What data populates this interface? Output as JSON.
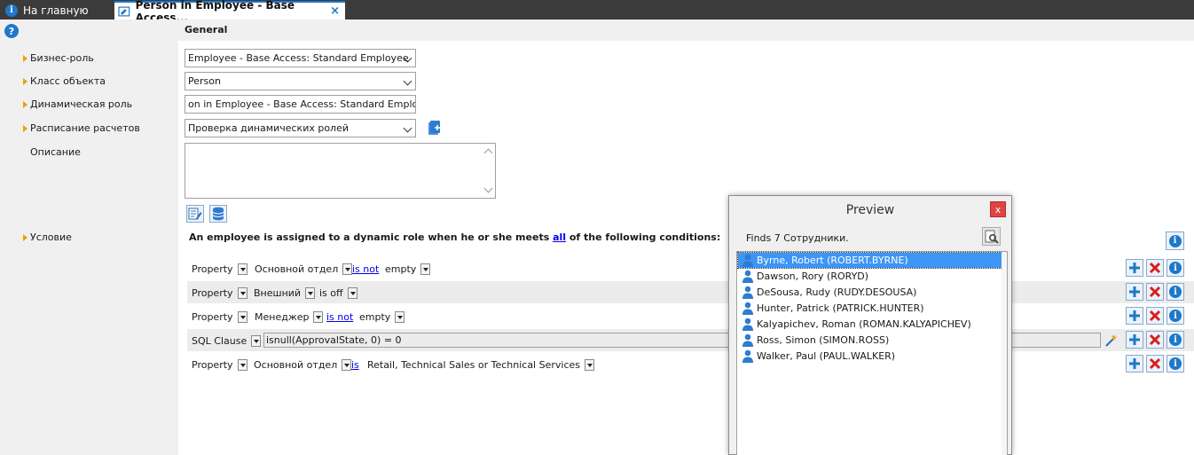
{
  "tabs": {
    "home_label": "На главную",
    "active_label": "Person in Employee - Base Access...",
    "close_symbol": "×"
  },
  "help_symbol": "?",
  "section_title": "General",
  "fields": {
    "business_role_label": "Бизнес-роль",
    "business_role_value": "Employee - Base Access: Standard Employee",
    "object_class_label": "Класс объекта",
    "object_class_value": "Person",
    "dynamic_role_label": "Динамическая роль",
    "dynamic_role_value": "on in Employee - Base Access: Standard Employee",
    "schedule_label": "Расписание расчетов",
    "schedule_value": "Проверка динамических ролей",
    "description_label": "Описание",
    "description_value": "",
    "condition_label": "Условие"
  },
  "condition": {
    "title_before": "An employee is assigned to a dynamic role when he or she meets ",
    "title_link": "all",
    "title_after": " of the following conditions:",
    "rows": [
      {
        "type": "Property",
        "property": "Основной отдел",
        "operator": "is not",
        "value": "empty"
      },
      {
        "type": "Property",
        "property": "Внешний",
        "operator": "is off"
      },
      {
        "type": "Property",
        "property": "Менеджер",
        "operator": "is not",
        "value": "empty"
      },
      {
        "type": "SQL Clause",
        "sql": "isnull(ApprovalState, 0) = 0"
      },
      {
        "type": "Property",
        "property": "Основной отдел",
        "operator": "is",
        "value": "Retail, Technical Sales or Technical Services"
      }
    ]
  },
  "preview": {
    "title": "Preview",
    "close_symbol": "x",
    "finds_text": "Finds 7 Сотрудники.",
    "items": [
      "Byrne, Robert (ROBERT.BYRNE)",
      "Dawson, Rory (RORYD)",
      "DeSousa, Rudy (RUDY.DESOUSA)",
      "Hunter, Patrick (PATRICK.HUNTER)",
      "Kalyapichev, Roman (ROMAN.KALYAPICHEV)",
      "Ross, Simon (SIMON.ROSS)",
      "Walker, Paul (PAUL.WALKER)"
    ],
    "selected_index": 0
  },
  "colors": {
    "accent": "#1e78c8",
    "tabbar": "#3b3b3b",
    "arrow": "#e8a200",
    "delete": "#d81e1e",
    "add": "#1e78c8",
    "selection": "#3d95f5"
  },
  "icons": {
    "home_tab": "info-icon",
    "active_tab": "document-icon",
    "add_schedule": "add-document-icon",
    "edit_text": "edit-text-icon",
    "database": "database-icon",
    "row_add": "plus-icon",
    "row_delete": "delete-x-icon",
    "row_info": "info-icon",
    "sql_wizard": "magic-wand-icon",
    "preview_search": "search-document-icon",
    "preview_person": "person-icon"
  }
}
